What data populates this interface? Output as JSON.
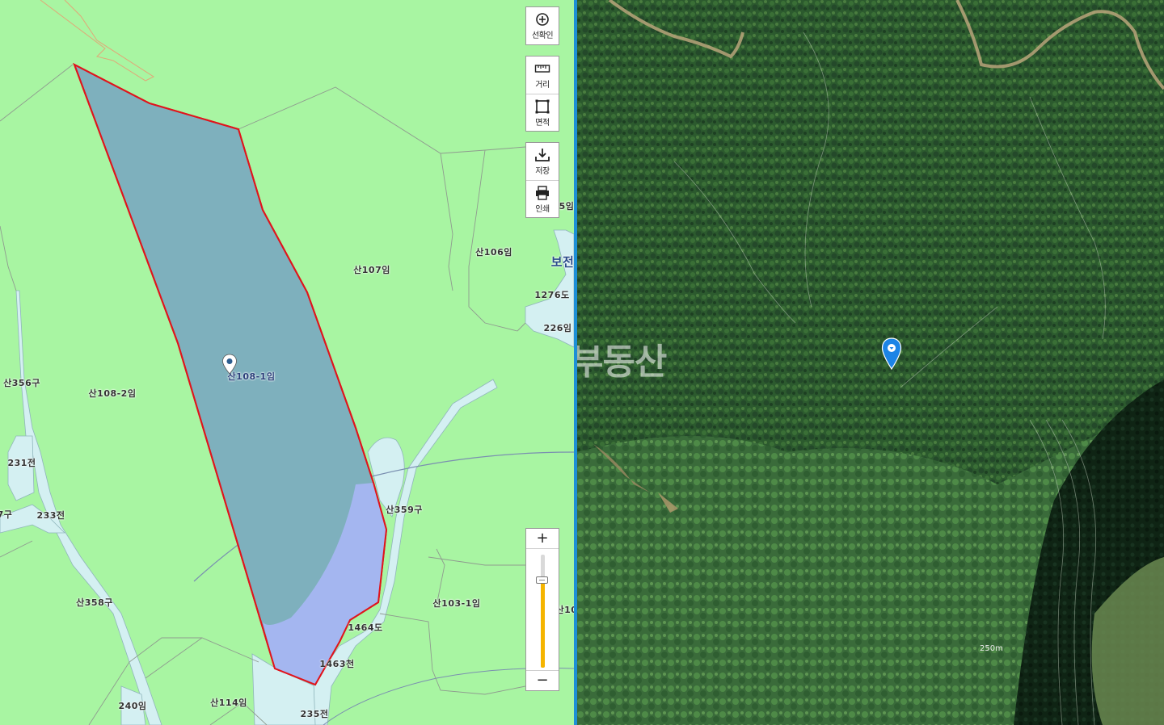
{
  "map": {
    "watermark": "당근부동산",
    "parcels": [
      {
        "label": "산108-1임",
        "selected": true
      },
      {
        "label": "산107임"
      },
      {
        "label": "산106임"
      },
      {
        "label": "산108-2임"
      },
      {
        "label": "산356구"
      },
      {
        "label": "231전"
      },
      {
        "label": "233전"
      },
      {
        "label": "7구"
      },
      {
        "label": "산358구"
      },
      {
        "label": "산359구"
      },
      {
        "label": "산103-1임"
      },
      {
        "label": "1464도"
      },
      {
        "label": "1463천"
      },
      {
        "label": "240임"
      },
      {
        "label": "산114임"
      },
      {
        "label": "235전"
      },
      {
        "label": "1276도"
      },
      {
        "label": "226임"
      },
      {
        "label": "5임"
      },
      {
        "label": "보전"
      },
      {
        "label": "산10"
      }
    ]
  },
  "toolbar": {
    "select_confirm": "선확인",
    "distance": "거리",
    "area": "면적",
    "save": "저장",
    "print": "인쇄"
  },
  "zoom": {
    "in_label": "+",
    "out_label": "−",
    "level_fraction": 0.78
  },
  "satellite": {
    "scale": "250m"
  },
  "colors": {
    "land": "#a8f5a2",
    "road": "#d4f0f2",
    "selected_fill": "#7eb0bd",
    "selected_outline": "#e0141c",
    "divider": "#1d8fd6",
    "zoom_fill": "#f5b400",
    "marker": "#1c84e6"
  }
}
